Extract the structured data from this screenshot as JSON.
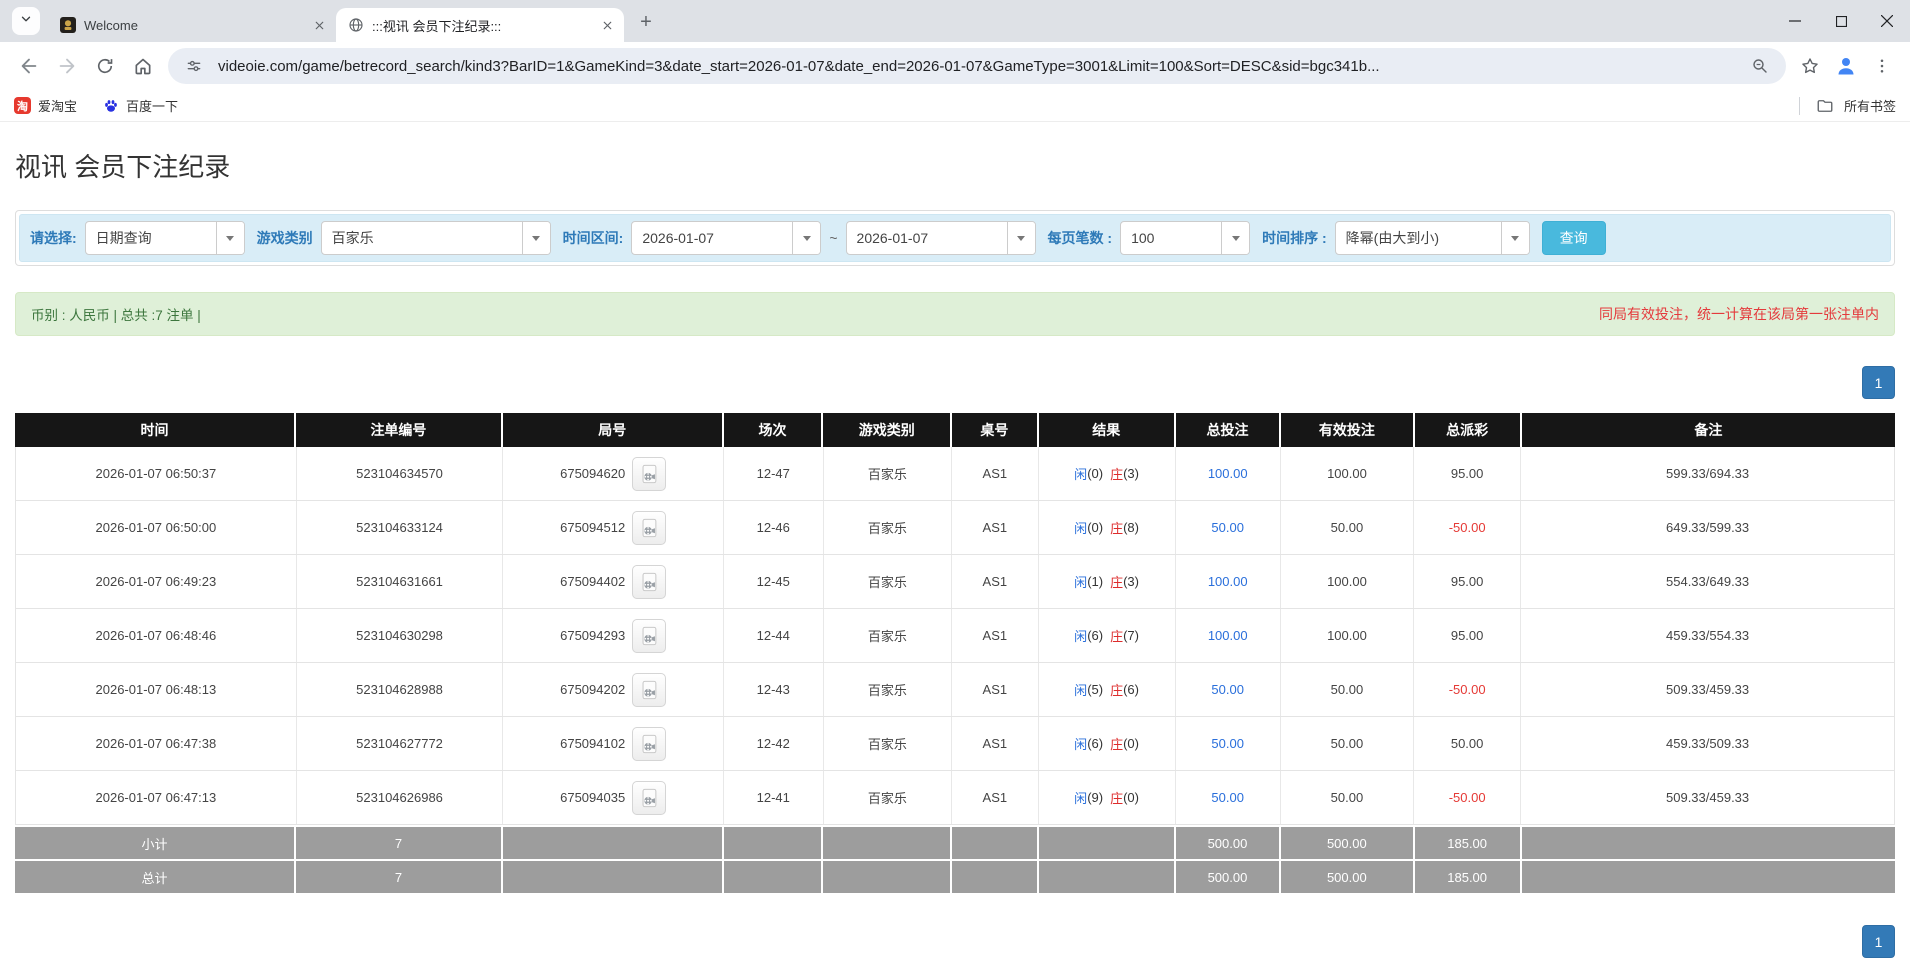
{
  "browser": {
    "tabs": [
      {
        "title": "Welcome"
      },
      {
        "title": ":::视讯 会员下注纪录:::"
      }
    ],
    "url": "videoie.com/game/betrecord_search/kind3?BarID=1&GameKind=3&date_start=2026-01-07&date_end=2026-01-07&GameType=3001&Limit=100&Sort=DESC&sid=bgc341b...",
    "bookmarks": [
      {
        "label": "爱淘宝"
      },
      {
        "label": "百度一下"
      }
    ],
    "all_bookmarks_label": "所有书签",
    "new_tab_label": "+"
  },
  "page": {
    "title": "视讯 会员下注纪录",
    "filters": {
      "select_label": "请选择:",
      "select_value": "日期查询",
      "game_kind_label": "游戏类别",
      "game_kind_value": "百家乐",
      "date_range_label": "时间区间:",
      "date_start": "2026-01-07",
      "tilde": "~",
      "date_end": "2026-01-07",
      "per_page_label": "每页笔数 :",
      "per_page_value": "100",
      "sort_label": "时间排序 :",
      "sort_value": "降幂(由大到小)",
      "search_button": "查询"
    },
    "summary": {
      "left": "币别 : 人民币 | 总共 :7 注单 |",
      "right": "同局有效投注，统一计算在该局第一张注单内"
    },
    "pagination_top": "1",
    "pagination_bottom": "1",
    "table": {
      "headers": [
        "时间",
        "注单编号",
        "局号",
        "场次",
        "游戏类别",
        "桌号",
        "结果",
        "总投注",
        "有效投注",
        "总派彩",
        "备注"
      ],
      "rows": [
        {
          "time": "2026-01-07 06:50:37",
          "bet_id": "523104634570",
          "round_id": "675094620",
          "session": "12-47",
          "game": "百家乐",
          "table_no": "AS1",
          "player": "闲",
          "player_n": "(0)",
          "banker": "庄",
          "banker_n": "(3)",
          "total_bet": "100.00",
          "valid_bet": "100.00",
          "payout": "95.00",
          "remark": "599.33/694.33"
        },
        {
          "time": "2026-01-07 06:50:00",
          "bet_id": "523104633124",
          "round_id": "675094512",
          "session": "12-46",
          "game": "百家乐",
          "table_no": "AS1",
          "player": "闲",
          "player_n": "(0)",
          "banker": "庄",
          "banker_n": "(8)",
          "total_bet": "50.00",
          "valid_bet": "50.00",
          "payout": "-50.00",
          "remark": "649.33/599.33"
        },
        {
          "time": "2026-01-07 06:49:23",
          "bet_id": "523104631661",
          "round_id": "675094402",
          "session": "12-45",
          "game": "百家乐",
          "table_no": "AS1",
          "player": "闲",
          "player_n": "(1)",
          "banker": "庄",
          "banker_n": "(3)",
          "total_bet": "100.00",
          "valid_bet": "100.00",
          "payout": "95.00",
          "remark": "554.33/649.33"
        },
        {
          "time": "2026-01-07 06:48:46",
          "bet_id": "523104630298",
          "round_id": "675094293",
          "session": "12-44",
          "game": "百家乐",
          "table_no": "AS1",
          "player": "闲",
          "player_n": "(6)",
          "banker": "庄",
          "banker_n": "(7)",
          "total_bet": "100.00",
          "valid_bet": "100.00",
          "payout": "95.00",
          "remark": "459.33/554.33"
        },
        {
          "time": "2026-01-07 06:48:13",
          "bet_id": "523104628988",
          "round_id": "675094202",
          "session": "12-43",
          "game": "百家乐",
          "table_no": "AS1",
          "player": "闲",
          "player_n": "(5)",
          "banker": "庄",
          "banker_n": "(6)",
          "total_bet": "50.00",
          "valid_bet": "50.00",
          "payout": "-50.00",
          "remark": "509.33/459.33"
        },
        {
          "time": "2026-01-07 06:47:38",
          "bet_id": "523104627772",
          "round_id": "675094102",
          "session": "12-42",
          "game": "百家乐",
          "table_no": "AS1",
          "player": "闲",
          "player_n": "(6)",
          "banker": "庄",
          "banker_n": "(0)",
          "total_bet": "50.00",
          "valid_bet": "50.00",
          "payout": "50.00",
          "remark": "459.33/509.33"
        },
        {
          "time": "2026-01-07 06:47:13",
          "bet_id": "523104626986",
          "round_id": "675094035",
          "session": "12-41",
          "game": "百家乐",
          "table_no": "AS1",
          "player": "闲",
          "player_n": "(9)",
          "banker": "庄",
          "banker_n": "(0)",
          "total_bet": "50.00",
          "valid_bet": "50.00",
          "payout": "-50.00",
          "remark": "509.33/459.33"
        }
      ],
      "footer_rows": [
        {
          "cells": [
            "小计",
            "7",
            "",
            "",
            "",
            "",
            "",
            "500.00",
            "500.00",
            "185.00",
            ""
          ]
        },
        {
          "cells": [
            "总计",
            "7",
            "",
            "",
            "",
            "",
            "",
            "500.00",
            "500.00",
            "185.00",
            ""
          ]
        }
      ]
    }
  },
  "colors": {
    "pagination_blue": "#337ab7",
    "search_button_cyan": "#49b9dd",
    "filter_bar_bg": "#d9edf7",
    "filter_label_blue": "#2e7ab8",
    "summary_bg": "#dff0d8",
    "summary_text_green": "#3c763d",
    "summary_note_red": "#e43a3c",
    "table_header_bg": "#161616",
    "table_footer_bg": "#9d9d9d",
    "player_blue": "#2a6fdb",
    "banker_red": "#dd2c2c",
    "loss_red": "#e53935",
    "link_blue": "#2a6fdb"
  },
  "icons": {
    "tab_search": "chevron-down-icon",
    "welcome_favicon": "casino-crest-icon",
    "active_tab_favicon": "globe-icon",
    "url_leading": "tune-icon",
    "url_trailing": "zoom-icon",
    "bookmark_1": "taobao-icon",
    "bookmark_2": "baidu-paw-icon",
    "bookmarks_right": "folder-icon",
    "round_cell": "video-replay-icon"
  }
}
